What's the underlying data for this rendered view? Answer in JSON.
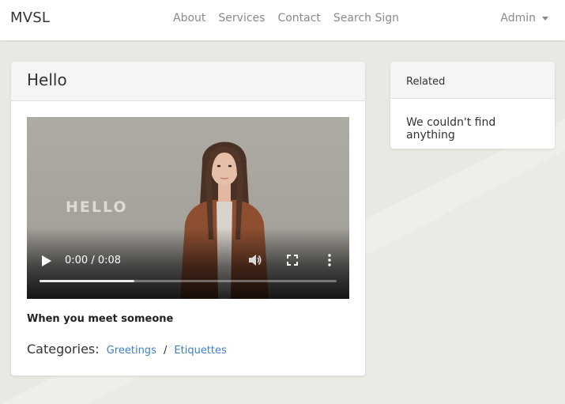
{
  "navbar": {
    "brand": "MVSL",
    "links": [
      "About",
      "Services",
      "Contact",
      "Search Sign"
    ],
    "user_menu": "Admin"
  },
  "main_card": {
    "title": "Hello",
    "video": {
      "overlay_text": "HELLO",
      "time_display": "0:00 / 0:08",
      "buffered_fraction": 0.32
    },
    "description": "When you meet someone",
    "categories_label": "Categories:",
    "categories": [
      "Greetings",
      "Etiquettes"
    ],
    "category_separator": "/"
  },
  "related_card": {
    "title": "Related",
    "empty_message": "We couldn't find anything"
  },
  "colors": {
    "page_background": "#e9e9e4",
    "link": "#3d7fc4",
    "nav_text": "#8a8a8a"
  },
  "icons": [
    "play-icon",
    "volume-icon",
    "fullscreen-icon",
    "more-vertical-icon",
    "caret-down-icon"
  ]
}
